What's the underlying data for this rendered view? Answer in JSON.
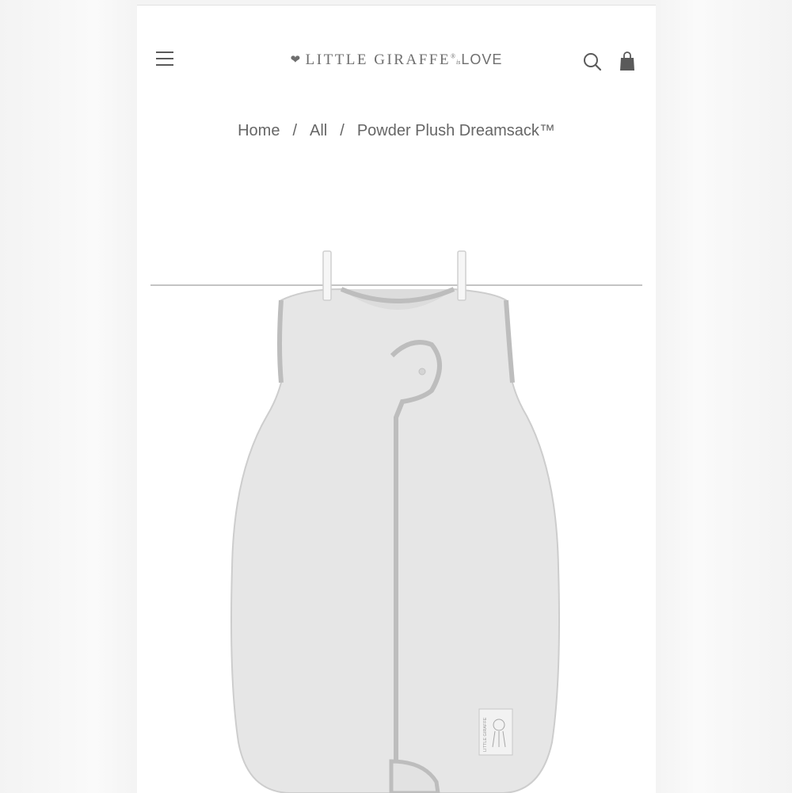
{
  "header": {
    "menu_icon": "hamburger-menu-icon",
    "logo": {
      "brand": "LITTLE GIRAFFE",
      "registered": "®",
      "connector": "is",
      "tagline": "LOVE"
    },
    "search_icon": "search-icon",
    "cart_icon": "shopping-bag-icon"
  },
  "breadcrumb": {
    "home": "Home",
    "separator": "/",
    "all": "All",
    "current": "Powder Plush Dreamsack™"
  },
  "product": {
    "image_icon": "sleep-sack-garment-image",
    "label_text": "LITTLE GIRAFFE"
  },
  "colors": {
    "text": "#666666",
    "garment": "#e4e4e4",
    "trim": "#c2c2c2"
  }
}
